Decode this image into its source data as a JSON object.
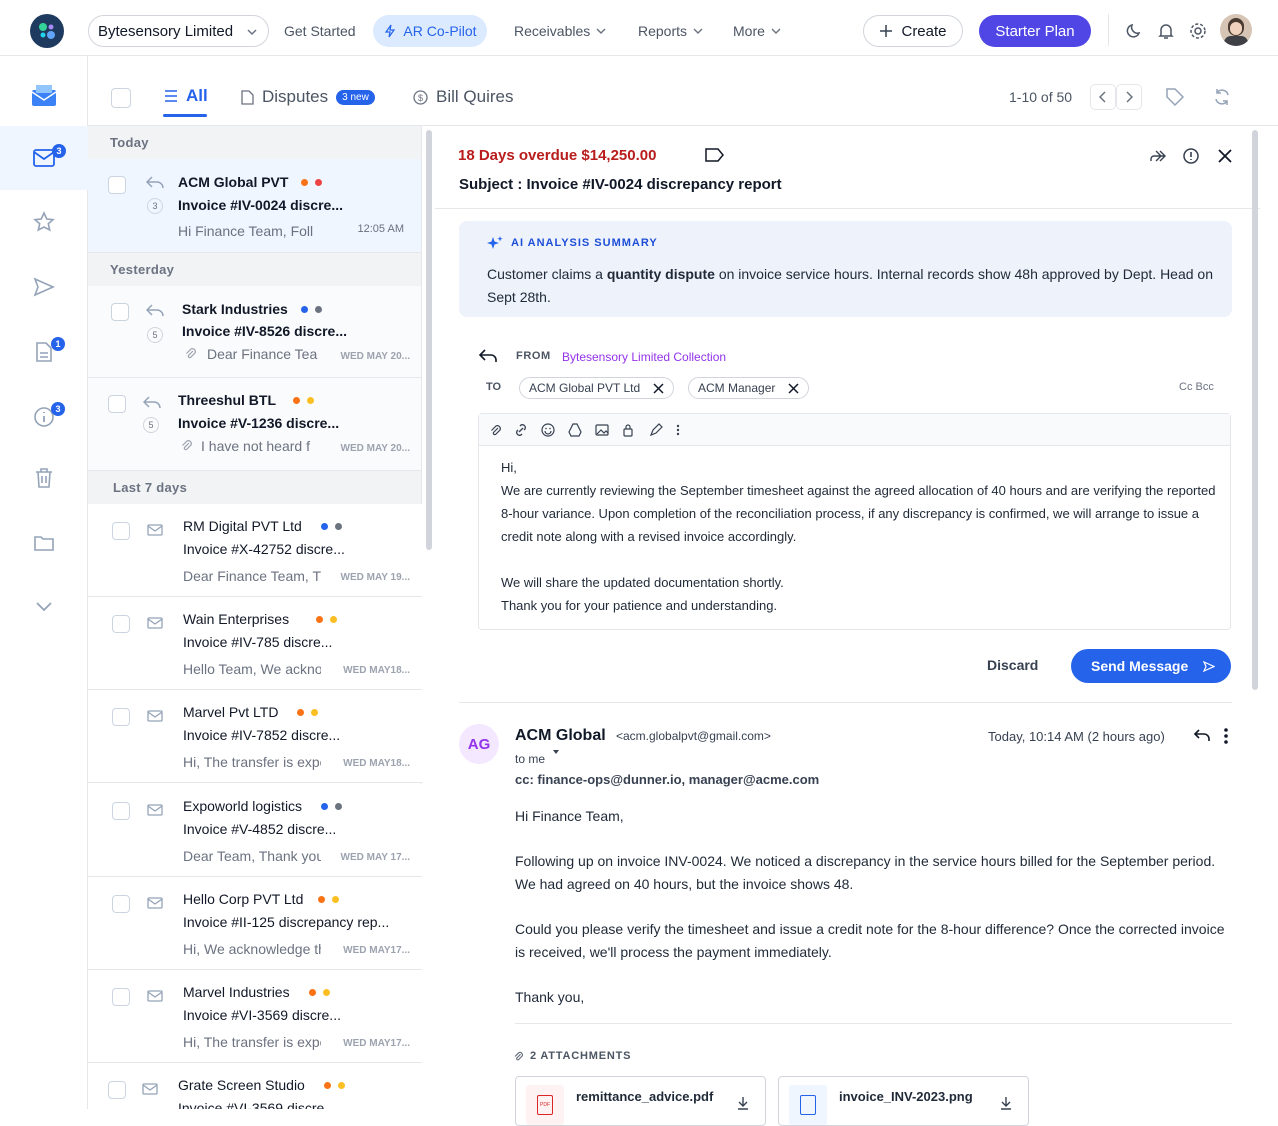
{
  "topbar": {
    "company": "Bytesensory Limited",
    "nav": [
      "Get Started",
      "AR Co-Pilot",
      "Receivables",
      "Reports",
      "More"
    ],
    "create": "Create",
    "plan": "Starter Plan"
  },
  "sidebar": {
    "badges": {
      "inbox": "3",
      "docs": "1",
      "info": "3"
    }
  },
  "tabs": {
    "all": "All",
    "disputes": "Disputes",
    "disputes_badge": "3 new",
    "bill": "Bill Quires",
    "paging": "1-10 of 50"
  },
  "groups": {
    "today": "Today",
    "yesterday": "Yesterday",
    "last7": "Last 7 days"
  },
  "items": [
    {
      "name": "ACM Global PVT",
      "subject": "Invoice #IV-0024 discre...",
      "preview": "Hi Finance Team, Foll",
      "time": "12:05 AM",
      "count": "3",
      "dots": [
        "#f97316",
        "#ef4444"
      ]
    },
    {
      "name": "Stark Industries",
      "subject": "Invoice #IV-8526 discre...",
      "preview": "Dear Finance Tea",
      "time": "WED MAY 20...",
      "count": "5",
      "dots": [
        "#2563eb",
        "#6b7280"
      ]
    },
    {
      "name": "Threeshul BTL",
      "subject": "Invoice #V-1236 discre...",
      "preview": "I have not heard f",
      "time": "WED MAY 20...",
      "count": "5",
      "dots": [
        "#f97316",
        "#fbbf24"
      ]
    },
    {
      "name": "RM Digital PVT Ltd",
      "subject": "Invoice #X-42752 discre...",
      "preview": "Dear Finance Team, Th",
      "time": "WED MAY 19...",
      "dots": [
        "#2563eb",
        "#6b7280"
      ]
    },
    {
      "name": "Wain Enterprises",
      "subject": "Invoice #IV-785 discre...",
      "preview": "Hello Team, We ackno",
      "time": "WED MAY18...",
      "dots": [
        "#f97316",
        "#fbbf24"
      ]
    },
    {
      "name": "Marvel Pvt LTD",
      "subject": "Invoice #IV-7852 discre...",
      "preview": "Hi, The transfer is expe",
      "time": "WED MAY18...",
      "dots": [
        "#f97316",
        "#fbbf24"
      ]
    },
    {
      "name": "Expoworld logistics",
      "subject": "Invoice #V-4852 discre...",
      "preview": "Dear Team, Thank you",
      "time": "WED MAY 17...",
      "dots": [
        "#2563eb",
        "#6b7280"
      ]
    },
    {
      "name": "Hello Corp PVT Ltd",
      "subject": "Invoice #II-125 discrepancy rep...",
      "preview": "Hi, We acknowledge th",
      "time": "WED MAY17...",
      "dots": [
        "#f97316",
        "#fbbf24"
      ]
    },
    {
      "name": "Marvel Industries",
      "subject": "Invoice #VI-3569 discre...",
      "preview": "Hi, The transfer is expe",
      "time": "WED MAY17...",
      "dots": [
        "#f97316",
        "#fbbf24"
      ]
    },
    {
      "name": "Grate Screen Studio",
      "subject": "Invoice #VI-3569 discre...",
      "preview": "",
      "time": "",
      "dots": [
        "#f97316",
        "#fbbf24"
      ]
    }
  ],
  "reader": {
    "overdue": "18 Days overdue $14,250.00",
    "subject": "Subject : Invoice #IV-0024 discrepancy report",
    "ai_title": "AI ANALYSIS SUMMARY",
    "ai_pre": "Customer claims a ",
    "ai_bold": "quantity dispute",
    "ai_post": " on invoice service hours. Internal records show 48h approved by Dept. Head on Sept 28th.",
    "from_label": "FROM",
    "from_value": "Bytesensory Limited Collection",
    "to_label": "TO",
    "to1": "ACM Global PVT Ltd",
    "to2": "ACM Manager",
    "ccbcc": "Cc Bcc",
    "body": [
      "Hi,",
      "We are currently reviewing the September timesheet against the agreed allocation of 40 hours and are verifying the reported 8-hour variance. Upon completion of the reconciliation process, if any discrepancy is confirmed, we will arrange to issue a credit note along with a revised invoice accordingly.",
      "",
      "We will share the updated documentation shortly.",
      "Thank you for your patience and understanding."
    ],
    "discard": "Discard",
    "send": "Send Message",
    "msg": {
      "avatar": "AG",
      "sender": "ACM Global",
      "email": "<acm.globalpvt@gmail.com>",
      "time": "Today, 10:14 AM (2 hours ago)",
      "tome": "to me",
      "cc": "cc: finance-ops@dunner.io, manager@acme.com",
      "p1": "Hi Finance Team,",
      "p2": "Following up on invoice INV-0024. We noticed a discrepancy in the service hours billed for the September period. We had agreed on 40 hours, but the invoice shows 48.",
      "p3": "Could you please verify the timesheet and issue a credit note for the 8-hour difference? Once the corrected invoice is received, we'll process the payment immediately.",
      "p4": "Thank you,",
      "attach_label": "2 ATTACHMENTS",
      "att1": "remittance_advice.pdf",
      "att2": "invoice_INV-2023.png"
    }
  }
}
